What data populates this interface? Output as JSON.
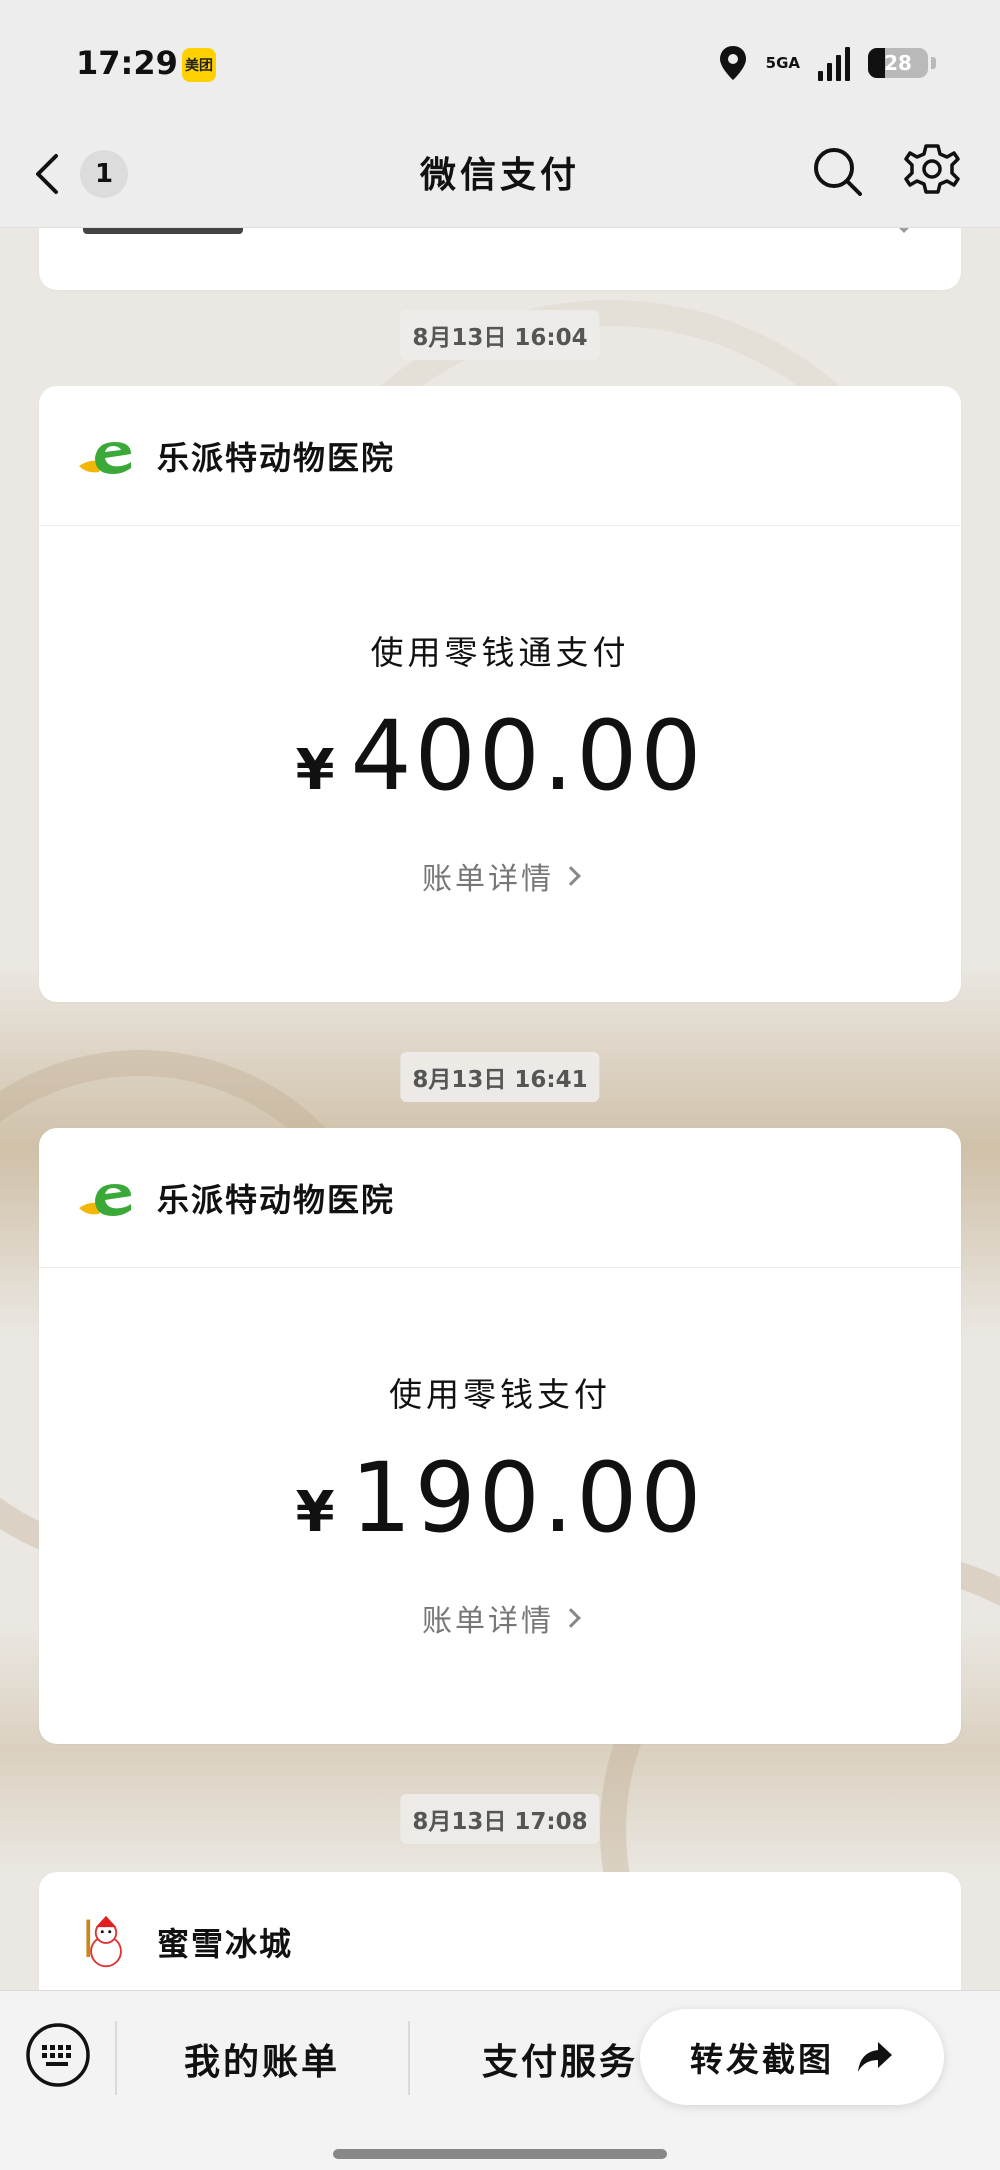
{
  "status_bar": {
    "time": "17:29",
    "app_badge": "美团",
    "network": "5GA",
    "battery": "28"
  },
  "nav": {
    "unread_count": "1",
    "title": "微信支付"
  },
  "messages": [
    {
      "timestamp": "8月13日 16:04",
      "merchant": "乐派特动物医院",
      "pay_method": "使用零钱通支付",
      "currency": "¥",
      "amount": "400.00",
      "bill_link": "账单详情"
    },
    {
      "timestamp": "8月13日 16:41",
      "merchant": "乐派特动物医院",
      "pay_method": "使用零钱支付",
      "currency": "¥",
      "amount": "190.00",
      "bill_link": "账单详情"
    },
    {
      "timestamp": "8月13日 17:08",
      "merchant": "蜜雪冰城"
    }
  ],
  "bottom_bar": {
    "my_bills": "我的账单",
    "pay_services": "支付服务",
    "share_screenshot": "转发截图"
  },
  "colors": {
    "merchant_logo_green": "#3aa938",
    "merchant_logo_yellow": "#f2b705",
    "page_bg": "#ebe8e3"
  }
}
